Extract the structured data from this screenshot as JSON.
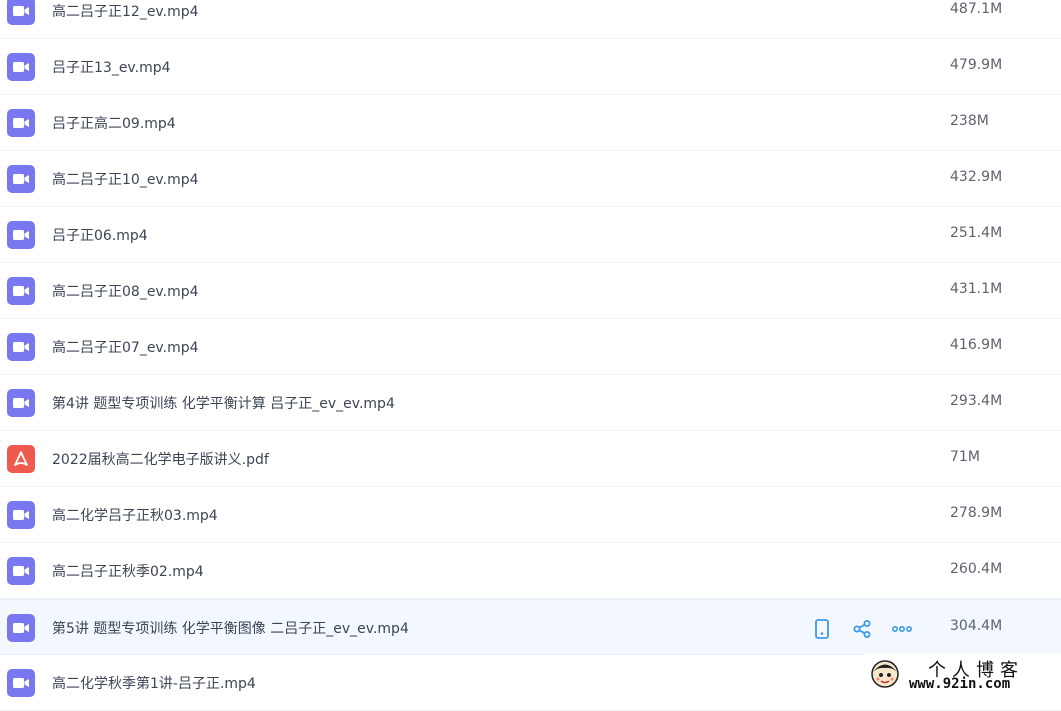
{
  "files": [
    {
      "name": "高二吕子正12_ev.mp4",
      "size": "487.1M",
      "type": "video"
    },
    {
      "name": "吕子正13_ev.mp4",
      "size": "479.9M",
      "type": "video"
    },
    {
      "name": "吕子正高二09.mp4",
      "size": "238M",
      "type": "video"
    },
    {
      "name": "高二吕子正10_ev.mp4",
      "size": "432.9M",
      "type": "video"
    },
    {
      "name": "吕子正06.mp4",
      "size": "251.4M",
      "type": "video"
    },
    {
      "name": "高二吕子正08_ev.mp4",
      "size": "431.1M",
      "type": "video"
    },
    {
      "name": "高二吕子正07_ev.mp4",
      "size": "416.9M",
      "type": "video"
    },
    {
      "name": "第4讲 题型专项训练 化学平衡计算 吕子正_ev_ev.mp4",
      "size": "293.4M",
      "type": "video"
    },
    {
      "name": "2022届秋高二化学电子版讲义.pdf",
      "size": "71M",
      "type": "pdf"
    },
    {
      "name": "高二化学吕子正秋03.mp4",
      "size": "278.9M",
      "type": "video"
    },
    {
      "name": "高二吕子正秋季02.mp4",
      "size": "260.4M",
      "type": "video"
    },
    {
      "name": "第5讲 题型专项训练 化学平衡图像 二吕子正_ev_ev.mp4",
      "size": "304.4M",
      "type": "video",
      "hovered": true
    },
    {
      "name": "高二化学秋季第1讲-吕子正.mp4",
      "size": "",
      "type": "video"
    }
  ],
  "row_actions": {
    "icons": [
      "phone-icon",
      "share-icon",
      "more-icon"
    ]
  },
  "colors": {
    "video_icon": "#7a78ef",
    "pdf_icon": "#f05a4e",
    "action_icon": "#3b9be6",
    "hover_row": "#f2f8fd"
  },
  "watermark": {
    "title": "个人博客",
    "url": "www.92in.com"
  }
}
